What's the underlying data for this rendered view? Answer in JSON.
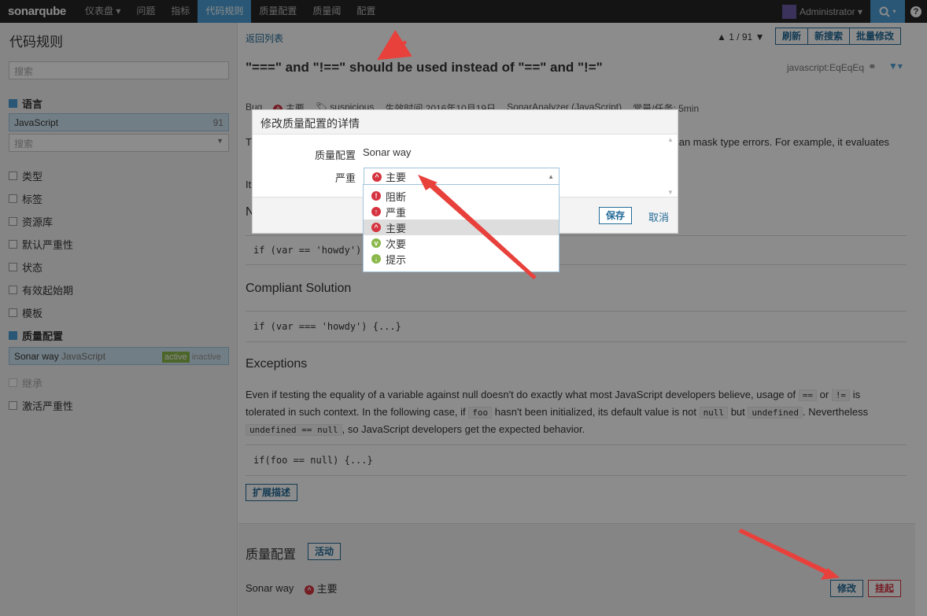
{
  "nav": {
    "logo": "sonarqube",
    "items": [
      "仪表盘 ▾",
      "问题",
      "指标",
      "代码规则",
      "质量配置",
      "质量阈",
      "配置"
    ],
    "user": "Administrator ▾",
    "search_icon": "search-icon",
    "help": "?"
  },
  "sidebar": {
    "title": "代码规则",
    "search_placeholder": "搜索",
    "language": {
      "label": "语言",
      "item": "JavaScript",
      "count": "91",
      "search_placeholder": "搜索"
    },
    "facets": [
      "类型",
      "标签",
      "资源库",
      "默认严重性",
      "状态",
      "有效起始期",
      "模板"
    ],
    "quality_profile": {
      "label": "质量配置",
      "profile": "Sonar way",
      "lang": "JavaScript",
      "active": "active",
      "inactive": "inactive"
    },
    "inherit": "继承",
    "active_severity": "激活严重性"
  },
  "main": {
    "back": "返回列表",
    "pager": "▲ 1 / 91 ▼",
    "buttons": {
      "refresh": "刷新",
      "new_search": "新搜索",
      "bulk": "批量修改"
    },
    "rule_title": "\"===\" and \"!==\" should be used instead of \"==\" and \"!=\"",
    "rule_key": "javascript:EqEqEq",
    "meta": {
      "type": "Bug",
      "severity": "主要",
      "tag": "suspicious",
      "date": "生效时间 2016年10月19日",
      "repo": "SonarAnalyzer (JavaScript)",
      "debt": "常量/任务: 5min"
    },
    "desc_fragment": "t can mask type errors. For example, it evaluates",
    "desc_fragment2": "It",
    "noncompliant_h": "N",
    "noncompliant_code": "if (var == 'howdy')",
    "compliant_h": "Compliant Solution",
    "compliant_code": "if (var === 'howdy') {...}",
    "exceptions_h": "Exceptions",
    "exceptions_p1a": "Even if testing the equality of a variable against null doesn't do exactly what most JavaScript developers believe, usage of",
    "exceptions_eq": "==",
    "exceptions_or": "or",
    "exceptions_neq": "!=",
    "exceptions_is": "is",
    "exceptions_p2a": "tolerated in such context. In the following case, if",
    "exceptions_foo": "foo",
    "exceptions_p2b": "hasn't been initialized, its default value is not",
    "exceptions_null": "null",
    "exceptions_but": "but",
    "exceptions_undef": "undefined",
    "exceptions_p2c": ". Nevertheless",
    "exceptions_code3": "undefined == null",
    "exceptions_p3": ", so JavaScript developers get the expected behavior.",
    "exceptions_code": "if(foo == null) {...}",
    "extend": "扩展描述",
    "qp_label": "质量配置",
    "qp_active": "活动",
    "qp_profile": "Sonar way",
    "qp_severity": "主要",
    "modify": "修改",
    "suspend": "挂起"
  },
  "modal": {
    "title": "修改质量配置的详情",
    "profile_label": "质量配置",
    "profile_value": "Sonar way",
    "severity_label": "严重",
    "selected": "主要",
    "save": "保存",
    "cancel": "取消",
    "options": [
      {
        "label": "阻断",
        "icon": "blocker-icon",
        "color": "#d4333f"
      },
      {
        "label": "严重",
        "icon": "critical-icon",
        "color": "#d4333f"
      },
      {
        "label": "主要",
        "icon": "major-icon",
        "color": "#d4333f"
      },
      {
        "label": "次要",
        "icon": "minor-icon",
        "color": "#8ab84b"
      },
      {
        "label": "提示",
        "icon": "info-icon",
        "color": "#8ab84b"
      }
    ]
  },
  "colors": {
    "accent": "#4b9fd5",
    "arrow": "#e8413c",
    "link": "#236a97"
  }
}
